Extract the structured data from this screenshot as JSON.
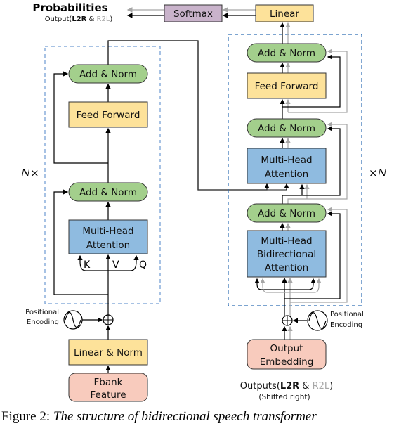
{
  "output": {
    "title": "Probabilities",
    "subtitle_prefix": "Output(",
    "l2r": "L2R",
    "amp": " & ",
    "r2l": "R2L",
    "subtitle_suffix": ")"
  },
  "top": {
    "softmax": "Softmax",
    "linear": "Linear"
  },
  "encoder": {
    "repeat_label": "N×",
    "add_norm_top": "Add & Norm",
    "feed_forward": "Feed Forward",
    "add_norm_bottom": "Add & Norm",
    "mha_line1": "Multi-Head",
    "mha_line2": "Attention",
    "k": "K",
    "v": "V",
    "q": "Q",
    "pos_enc_line1": "Positional",
    "pos_enc_line2": "Encoding",
    "linear_norm": "Linear & Norm",
    "input_line1": "Fbank",
    "input_line2": "Feature"
  },
  "decoder": {
    "repeat_label": "×N",
    "add_norm_top": "Add & Norm",
    "feed_forward": "Feed Forward",
    "add_norm_mid": "Add & Norm",
    "mha_line1": "Multi-Head",
    "mha_line2": "Attention",
    "add_norm_bottom": "Add & Norm",
    "bmha_line1": "Multi-Head",
    "bmha_line2": "Bidirectional",
    "bmha_line3": "Attention",
    "pos_enc_line1": "Positional",
    "pos_enc_line2": "Encoding",
    "embed_line1": "Output",
    "embed_line2": "Embedding",
    "outputs_prefix": "Outputs(",
    "l2r": "L2R",
    "amp": " & ",
    "r2l": "R2L",
    "outputs_suffix": ")",
    "shifted": "(Shifted right)"
  },
  "caption": {
    "prefix": "Figure 2: ",
    "text": "The structure of bidirectional speech transformer"
  },
  "colors": {
    "add_norm": "#a3cf8c",
    "feed_forward": "#fde29a",
    "attention": "#8fbbe0",
    "softmax": "#c9b3cb",
    "embedding": "#f8cbbd",
    "dashed_border": "#2e6db4",
    "r2l_gray": "#a6a6a6"
  }
}
